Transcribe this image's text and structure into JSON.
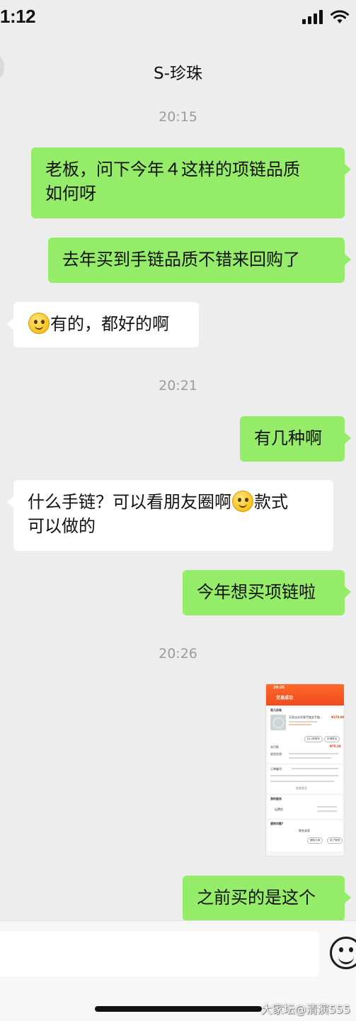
{
  "status_bar": {
    "time": "1:12",
    "icons": [
      "signal-icon",
      "wifi-icon"
    ]
  },
  "nav": {
    "title": "S-珍珠"
  },
  "timestamps": [
    "20:15",
    "20:21",
    "20:26"
  ],
  "messages": {
    "m1": {
      "line1": "老板，问下今年４这样的项链品质",
      "line2": "如何呀"
    },
    "m2": {
      "text": "去年买到手链品质不错来回购了"
    },
    "m3": {
      "text": "有的，都好的啊"
    },
    "m4": {
      "text": "有几种啊"
    },
    "m5": {
      "line1_a": "什么手链？可以看朋友圈啊",
      "line1_b": "款式",
      "line2": "可以做的"
    },
    "m6": {
      "text": "今年想买项链啦"
    },
    "m8": {
      "text": "之前买的是这个"
    }
  },
  "image_message": {
    "time": "20:20",
    "title": "交易成功",
    "shop": "菲几珍珠",
    "price": "¥178.00",
    "paid": "¥75.29",
    "product": "天然淡水珍珠手链女手链…",
    "labels": [
      "实付款",
      "收货信息:",
      "订单编号:",
      "我的服务",
      "运费险",
      "遇到问题?",
      "联系卖家",
      "删除订单",
      "卖了换钱",
      "加入购物车",
      "申请售后",
      "查看更多"
    ]
  },
  "colors": {
    "background": "#ededed",
    "my_bubble": "#95ec69",
    "their_bubble": "#ffffff",
    "timestamp": "#9b9b9b"
  },
  "watermark": "大家坛@清演555"
}
